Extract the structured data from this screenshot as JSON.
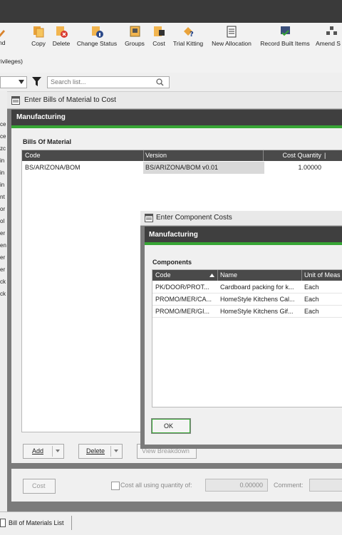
{
  "ribbon": {
    "items": [
      {
        "label": "Copy",
        "icon": "copy-icon"
      },
      {
        "label": "Delete",
        "icon": "delete-icon"
      },
      {
        "label": "Change Status",
        "icon": "change-status-icon"
      },
      {
        "label": "Groups",
        "icon": "groups-icon"
      },
      {
        "label": "Cost",
        "icon": "cost-icon"
      },
      {
        "label": "Trial Kitting",
        "icon": "trial-kitting-icon"
      },
      {
        "label": "New Allocation",
        "icon": "new-allocation-icon"
      },
      {
        "label": "Record Built Items",
        "icon": "record-built-items-icon"
      },
      {
        "label": "Amend S",
        "icon": "amend-icon"
      }
    ],
    "cut_left_line1": "nd",
    "cut_left_line2": "rivileges)"
  },
  "search": {
    "placeholder": "Search list...",
    "filter_icon": "funnel-icon"
  },
  "left_list": {
    "rows": [
      "ce",
      "ce",
      "zc",
      "in",
      "in",
      "in",
      "nt",
      "or",
      "ol",
      "er",
      "en",
      "er",
      "er",
      "ck",
      "ck"
    ]
  },
  "window1": {
    "title": "Enter Bills of Material to Cost",
    "header": "Manufacturing",
    "section_title": "Bills Of Material",
    "columns": [
      "Code",
      "Version",
      "Cost Quantity"
    ],
    "rows": [
      {
        "code": "BS/ARIZONA/BOM",
        "version": "BS/ARIZONA/BOM v0.01",
        "qty": "1.00000"
      }
    ],
    "add_label": "Add",
    "delete_label": "Delete",
    "view_breakdown_label": "View Breakdown",
    "cost_label": "Cost",
    "cost_all_label": "Cost all using quantity of:",
    "quantity_value": "0.00000",
    "comment_label": "Comment:"
  },
  "window2": {
    "title": "Enter Component Costs",
    "header": "Manufacturing",
    "section_title": "Components",
    "columns": [
      "Code",
      "Name",
      "Unit of Meas"
    ],
    "rows": [
      {
        "code": "PK/DOOR/PROT...",
        "name": "Cardboard packing for k...",
        "unit": "Each"
      },
      {
        "code": "PROMO/MER/CA...",
        "name": "HomeStyle Kitchens Cal...",
        "unit": "Each"
      },
      {
        "code": "PROMO/MER/GI...",
        "name": "HomeStyle Kitchens Gif...",
        "unit": "Each"
      }
    ],
    "ok_label": "OK"
  },
  "statusbar": {
    "tab_label": "Bill of Materials List"
  },
  "colors": {
    "green": "#37a535",
    "dark_header": "#3f3f3f",
    "grid_header": "#4a4a4a"
  }
}
